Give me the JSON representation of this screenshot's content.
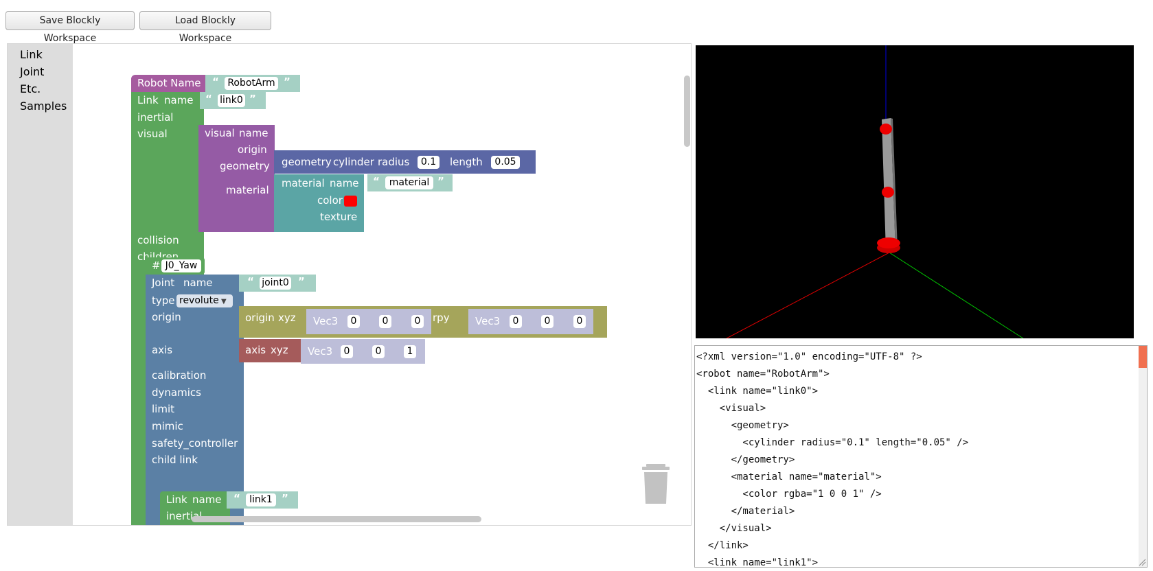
{
  "buttons": {
    "save": "Save Blockly Workspace",
    "load": "Load Blockly Workspace"
  },
  "toolbox": {
    "items": [
      "Link",
      "Joint",
      "Etc.",
      "Samples"
    ]
  },
  "blocks": {
    "robot": {
      "label": "Robot Name",
      "value": "RobotArm"
    },
    "link0": {
      "link_label": "Link",
      "name_label": "name",
      "name_value": "link0",
      "inertial": "inertial",
      "visual": "visual",
      "collision": "collision",
      "children": "children"
    },
    "visual0": {
      "visual_label": "visual",
      "name_label": "name",
      "origin": "origin",
      "geometry": "geometry",
      "material": "material"
    },
    "geometry": {
      "geometry_label": "geometry",
      "shape": "cylinder",
      "radius_label": "radius",
      "radius": "0.1",
      "length_label": "length",
      "length": "0.05"
    },
    "material": {
      "material_label": "material",
      "name_label": "name",
      "name_value": "material",
      "color_label": "color",
      "texture_label": "texture",
      "color": "#ff0000"
    },
    "joint_ref": {
      "hash": "#",
      "value": "J0_Yaw"
    },
    "joint0": {
      "joint_label": "Joint",
      "name_label": "name",
      "name_value": "joint0",
      "type_label": "type",
      "type_value": "revolute",
      "origin": "origin",
      "axis": "axis",
      "calibration": "calibration",
      "dynamics": "dynamics",
      "limit": "limit",
      "mimic": "mimic",
      "safety_controller": "safety_controller",
      "child_link": "child link"
    },
    "origin_blk": {
      "origin_label": "origin",
      "xyz_label": "xyz",
      "rpy_label": "rpy",
      "vec_label": "Vec3",
      "xyz": [
        "0",
        "0",
        "0"
      ],
      "rpy": [
        "0",
        "0",
        "0"
      ]
    },
    "axis_blk": {
      "axis_label": "axis",
      "xyz_label": "xyz",
      "vec_label": "Vec3",
      "xyz": [
        "0",
        "0",
        "1"
      ]
    },
    "link1": {
      "link_label": "Link",
      "name_label": "name",
      "name_value": "link1",
      "inertial": "inertial"
    }
  },
  "code": {
    "lines": [
      "<?xml version=\"1.0\" encoding=\"UTF-8\" ?>",
      "<robot name=\"RobotArm\">",
      "  <link name=\"link0\">",
      "    <visual>",
      "      <geometry>",
      "        <cylinder radius=\"0.1\" length=\"0.05\" />",
      "      </geometry>",
      "      <material name=\"material\">",
      "        <color rgba=\"1 0 0 1\" />",
      "      </material>",
      "    </visual>",
      "  </link>",
      "  <link name=\"link1\">"
    ]
  },
  "colors": {
    "robot_block": "#a55b9f",
    "link_block": "#5ba65b",
    "visual_block": "#955ba5",
    "geometry_block": "#5b67a5",
    "material_block": "#5ba5a5",
    "joint_block": "#5b80a5",
    "origin_block": "#a5a55b",
    "axis_block": "#a55b5b",
    "vec3_block": "#bdbed9",
    "string_block": "#a5d0c4",
    "viewer_bg": "#000000",
    "axis_x": "#e00000",
    "axis_y": "#00c000",
    "axis_z": "#0000e0",
    "robot_marker": "#e00000",
    "arm_segment": "#9a9a9a"
  }
}
